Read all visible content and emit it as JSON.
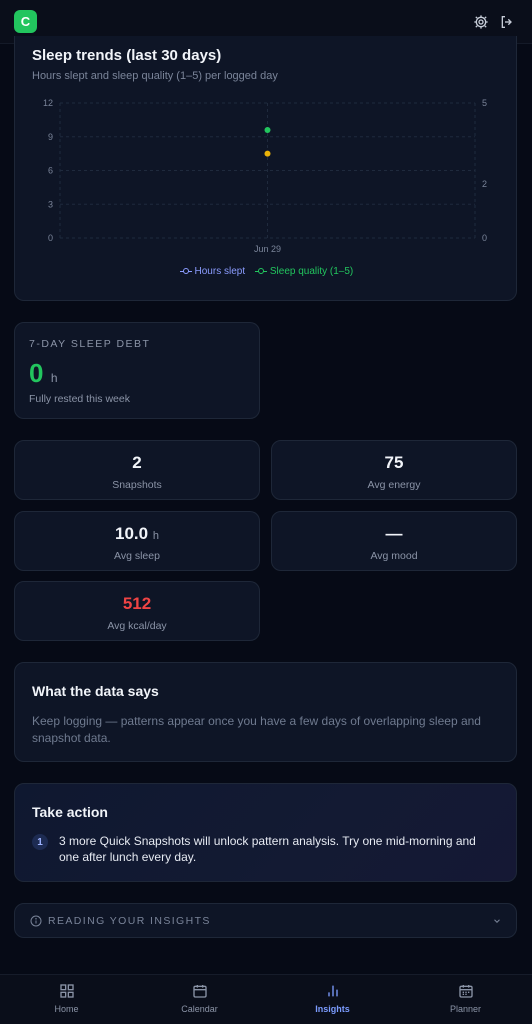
{
  "app": {
    "logo_letter": "C"
  },
  "sleep_chart": {
    "title": "Sleep trends (last 30 days)",
    "subtitle": "Hours slept and sleep quality (1–5) per logged day",
    "legend": [
      "Hours slept",
      "Sleep quality (1–5)"
    ]
  },
  "chart_data": {
    "type": "line",
    "title": "Sleep trends (last 30 days)",
    "x": [
      "Jun 29"
    ],
    "series": [
      {
        "name": "Hours slept",
        "values": [
          7.5
        ],
        "axis": "left",
        "color": "#eab308"
      },
      {
        "name": "Sleep quality (1–5)",
        "values": [
          4
        ],
        "axis": "right",
        "color": "#22c55e"
      }
    ],
    "left_ticks": [
      0,
      3,
      6,
      9,
      12
    ],
    "right_ticks": [
      0,
      2,
      5
    ],
    "ylim_left": [
      0,
      12
    ],
    "ylim_right": [
      0,
      5
    ],
    "grid": true,
    "legend_position": "bottom"
  },
  "sleep_debt": {
    "label": "7-DAY SLEEP DEBT",
    "value": "0",
    "unit": "h",
    "note": "Fully rested this week"
  },
  "stats": {
    "snapshots": {
      "value": "2",
      "label": "Snapshots"
    },
    "avg_energy": {
      "value": "75",
      "label": "Avg energy"
    },
    "avg_sleep": {
      "value": "10.0",
      "unit": "h",
      "label": "Avg sleep"
    },
    "avg_mood": {
      "value": "—",
      "label": "Avg mood"
    },
    "avg_kcal": {
      "value": "512",
      "label": "Avg kcal/day"
    }
  },
  "data_says": {
    "title": "What the data says",
    "text": "Keep logging — patterns appear once you have a few days of overlapping sleep and snapshot data."
  },
  "take_action": {
    "title": "Take action",
    "items": [
      {
        "num": "1",
        "text": "3 more Quick Snapshots will unlock pattern analysis. Try one mid-morning and one after lunch every day."
      }
    ]
  },
  "reading": {
    "label": "READING YOUR INSIGHTS"
  },
  "nav": {
    "items": [
      {
        "label": "Home",
        "icon": "grid-icon"
      },
      {
        "label": "Calendar",
        "icon": "calendar-icon"
      },
      {
        "label": "Insights",
        "icon": "bar-chart-icon",
        "active": true
      },
      {
        "label": "Planner",
        "icon": "calendar-grid-icon"
      }
    ]
  },
  "colors": {
    "accent": "#7c9cff",
    "success": "#22c55e",
    "warning": "#eab308",
    "danger": "#ef4444"
  }
}
